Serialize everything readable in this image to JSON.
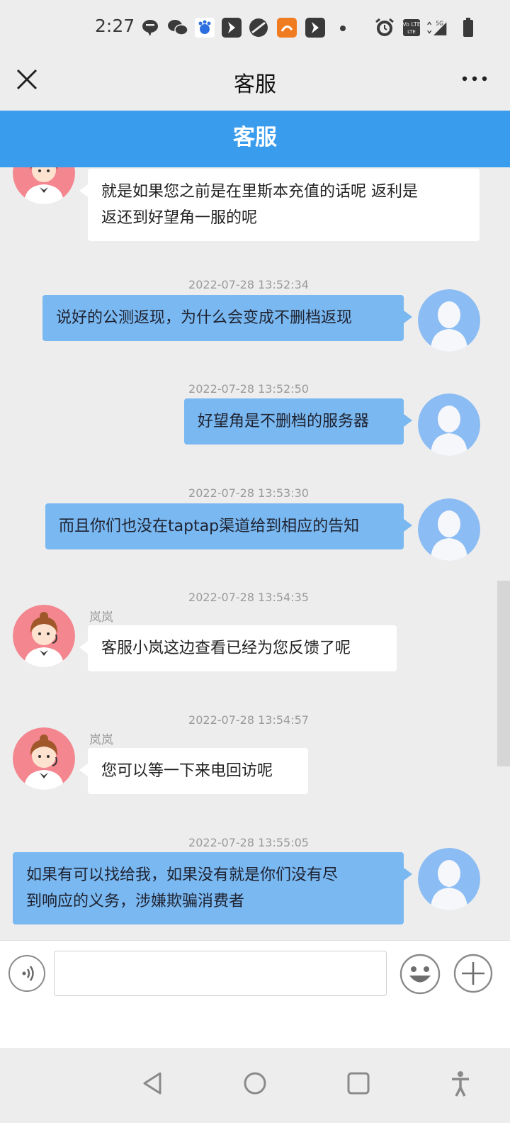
{
  "status_bar": {
    "time": "2:27",
    "icons": [
      "chat-bubble-icon",
      "wechat-icon",
      "baidu-icon",
      "app-arrow-icon",
      "no-disturb-icon",
      "uc-browser-icon",
      "app-arrow-icon",
      "dot-icon",
      "alarm-icon",
      "volte-icon",
      "signal-5g-icon",
      "battery-icon"
    ],
    "volte_label": "Vo LTE",
    "network_label": "5G"
  },
  "title_bar": {
    "title": "客服"
  },
  "header": {
    "title": "客服"
  },
  "messages": [
    {
      "side": "agent",
      "sender": "",
      "timestamp": "",
      "lines": [
        "就是如果您之前是在里斯本充值的话呢 返利是",
        "返还到好望角一服的呢"
      ]
    },
    {
      "side": "user",
      "timestamp": "2022-07-28 13:52:34",
      "lines": [
        "说好的公测返现，为什么会变成不删档返现"
      ]
    },
    {
      "side": "user",
      "timestamp": "2022-07-28 13:52:50",
      "lines": [
        "好望角是不删档的服务器"
      ]
    },
    {
      "side": "user",
      "timestamp": "2022-07-28 13:53:30",
      "lines": [
        "而且你们也没在taptap渠道给到相应的告知"
      ]
    },
    {
      "side": "agent",
      "sender": "岚岚",
      "timestamp": "2022-07-28 13:54:35",
      "lines": [
        "客服小岚这边查看已经为您反馈了呢"
      ]
    },
    {
      "side": "agent",
      "sender": "岚岚",
      "timestamp": "2022-07-28 13:54:57",
      "lines": [
        "您可以等一下来电回访呢"
      ]
    },
    {
      "side": "user",
      "timestamp": "2022-07-28 13:55:05",
      "lines": [
        "如果有可以找给我，如果没有就是你们没有尽",
        "到响应的义务，涉嫌欺骗消费者"
      ]
    }
  ],
  "input_bar": {
    "placeholder": "",
    "value": ""
  },
  "colors": {
    "header_blue": "#3a9ced",
    "user_bubble": "#7ab8f1",
    "agent_bubble": "#ffffff",
    "background": "#ededed"
  }
}
